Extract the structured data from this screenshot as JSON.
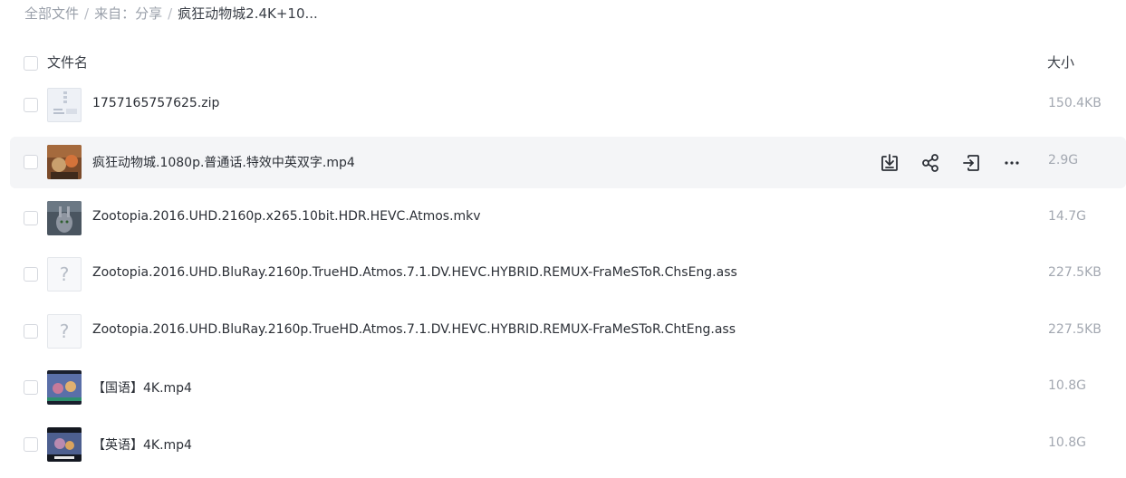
{
  "breadcrumb": {
    "items": [
      "全部文件",
      "来自：分享"
    ],
    "current": "疯狂动物城2.4K+10..."
  },
  "table": {
    "header_name": "文件名",
    "header_size": "大小",
    "rows": [
      {
        "name": "1757165757625.zip",
        "size": "150.4KB",
        "type": "zip-file-icon"
      },
      {
        "name": "疯狂动物城.1080p.普通话.特效中英双字.mp4",
        "size": "2.9G",
        "type": "video-thumbnail",
        "hovered": true
      },
      {
        "name": "Zootopia.2016.UHD.2160p.x265.10bit.HDR.HEVC.Atmos.mkv",
        "size": "14.7G",
        "type": "video-thumbnail"
      },
      {
        "name": "Zootopia.2016.UHD.BluRay.2160p.TrueHD.Atmos.7.1.DV.HEVC.HYBRID.REMUX-FraMeSToR.ChsEng.ass",
        "size": "227.5KB",
        "type": "unknown-file-icon"
      },
      {
        "name": "Zootopia.2016.UHD.BluRay.2160p.TrueHD.Atmos.7.1.DV.HEVC.HYBRID.REMUX-FraMeSToR.ChtEng.ass",
        "size": "227.5KB",
        "type": "unknown-file-icon"
      },
      {
        "name": "【国语】4K.mp4",
        "size": "10.8G",
        "type": "video-thumbnail"
      },
      {
        "name": "【英语】4K.mp4",
        "size": "10.8G",
        "type": "video-thumbnail"
      }
    ]
  },
  "row_actions": [
    "download-icon",
    "share-icon",
    "move-icon",
    "more-icon"
  ],
  "unknown_glyph": "?",
  "colors": {
    "hover_bg": "#f4f5f7",
    "icon": "#2b2f36",
    "muted": "#a3a8b1"
  }
}
